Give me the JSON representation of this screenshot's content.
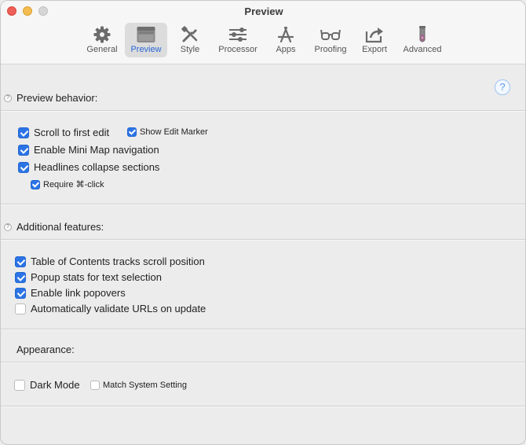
{
  "window": {
    "title": "Preview"
  },
  "toolbar": {
    "tabs": [
      {
        "label": "General",
        "icon": "gear-icon"
      },
      {
        "label": "Preview",
        "icon": "preview-window-icon"
      },
      {
        "label": "Style",
        "icon": "style-tools-icon"
      },
      {
        "label": "Processor",
        "icon": "sliders-icon"
      },
      {
        "label": "Apps",
        "icon": "apps-icon"
      },
      {
        "label": "Proofing",
        "icon": "glasses-icon"
      },
      {
        "label": "Export",
        "icon": "export-icon"
      },
      {
        "label": "Advanced",
        "icon": "test-tube-icon"
      }
    ],
    "active": "Preview",
    "accent": "#2a67d8"
  },
  "help": {
    "big": "?",
    "small": "?"
  },
  "sections": {
    "preview_behavior": {
      "title": "Preview behavior:",
      "options": [
        {
          "label": "Scroll to first edit",
          "checked": true
        },
        {
          "label": "Show Edit Marker",
          "checked": true
        },
        {
          "label": "Enable Mini Map navigation",
          "checked": true
        },
        {
          "label": "Headlines collapse sections",
          "checked": true
        },
        {
          "label": "Require ⌘-click",
          "checked": true
        }
      ]
    },
    "additional_features": {
      "title": "Additional features:",
      "options": [
        {
          "label": "Table of Contents tracks scroll position",
          "checked": true
        },
        {
          "label": "Popup stats for text selection",
          "checked": true
        },
        {
          "label": "Enable link popovers",
          "checked": true
        },
        {
          "label": "Automatically validate URLs on update",
          "checked": false
        }
      ]
    },
    "appearance": {
      "title": "Appearance:",
      "options": [
        {
          "label": "Dark Mode",
          "checked": false
        },
        {
          "label": "Match System Setting",
          "checked": false
        }
      ]
    }
  },
  "colors": {
    "checkbox_on": "#2b74e6",
    "help_blue": "#5b9be5"
  }
}
